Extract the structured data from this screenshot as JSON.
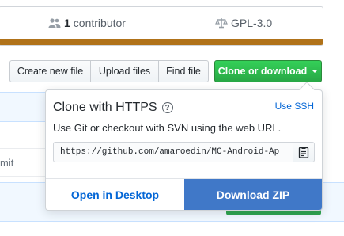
{
  "summary": {
    "contributors_count": "1",
    "contributors_label": "contributor",
    "license": "GPL-3.0",
    "language_color": "#b07219"
  },
  "file_actions": {
    "create_new_file": "Create new file",
    "upload_files": "Upload files",
    "find_file": "Find file",
    "clone_or_download": "Clone or download"
  },
  "background": {
    "commit_fragment": "mit"
  },
  "clone_popup": {
    "title": "Clone with HTTPS",
    "help_glyph": "?",
    "use_ssh": "Use SSH",
    "description": "Use Git or checkout with SVN using the web URL.",
    "url": "https://github.com/amaroedin/MC-Android-Ap",
    "open_in_desktop": "Open in Desktop",
    "download_zip": "Download ZIP"
  },
  "colors": {
    "accent_link": "#0366d6",
    "primary_green": "#28a745",
    "download_blue": "#4078c8"
  }
}
